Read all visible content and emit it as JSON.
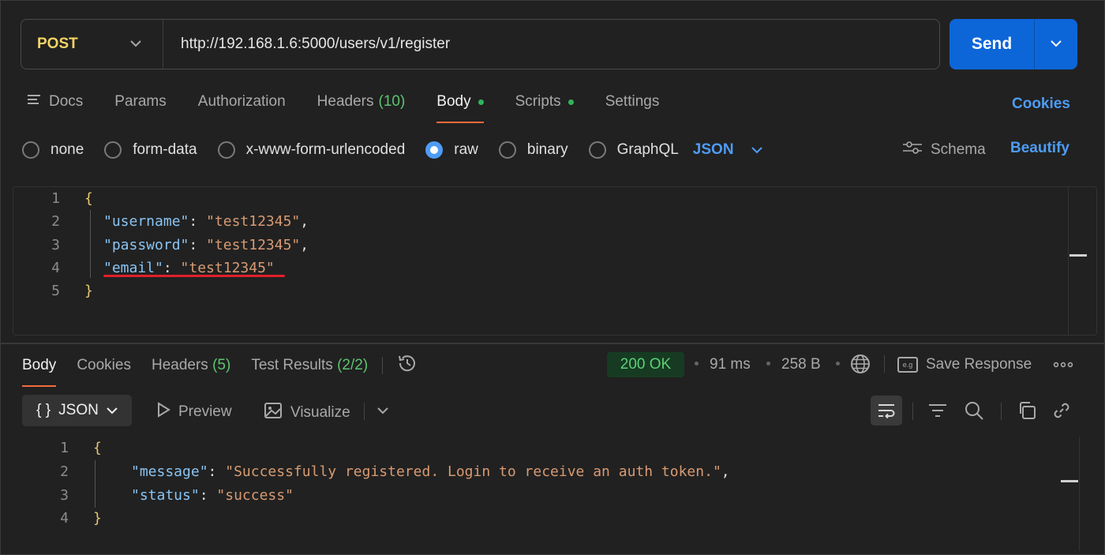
{
  "request": {
    "method": "POST",
    "url": "http://192.168.1.6:5000/users/v1/register",
    "send_label": "Send"
  },
  "request_tabs": {
    "docs": "Docs",
    "params": "Params",
    "authorization": "Authorization",
    "headers": "Headers",
    "headers_count": "(10)",
    "body": "Body",
    "scripts": "Scripts",
    "settings": "Settings",
    "cookies": "Cookies"
  },
  "body_types": {
    "none": "none",
    "form_data": "form-data",
    "urlencoded": "x-www-form-urlencoded",
    "raw": "raw",
    "binary": "binary",
    "graphql": "GraphQL",
    "format": "JSON",
    "schema": "Schema",
    "beautify": "Beautify",
    "selected": "raw"
  },
  "request_body": {
    "line_numbers": [
      "1",
      "2",
      "3",
      "4",
      "5"
    ],
    "open_brace": "{",
    "close_brace": "}",
    "fields": [
      {
        "key": "\"username\"",
        "value": "\"test12345\"",
        "trail": ","
      },
      {
        "key": "\"password\"",
        "value": "\"test12345\"",
        "trail": ","
      },
      {
        "key": "\"email\"",
        "value": "\"test12345\"",
        "trail": ""
      }
    ]
  },
  "response_tabs": {
    "body": "Body",
    "cookies": "Cookies",
    "headers": "Headers",
    "headers_count": "(5)",
    "test_results": "Test Results",
    "test_count": "(2/2)"
  },
  "response_meta": {
    "status": "200 OK",
    "time": "91 ms",
    "size": "258 B",
    "save_response": "Save Response",
    "save_icon_text": "e.g"
  },
  "response_toolbar": {
    "format": "JSON",
    "format_icon": "{ }",
    "preview": "Preview",
    "visualize": "Visualize"
  },
  "response_body": {
    "line_numbers": [
      "1",
      "2",
      "3",
      "4"
    ],
    "open_brace": "{",
    "close_brace": "}",
    "fields": [
      {
        "key": "\"message\"",
        "value": "\"Successfully registered. Login to receive an auth token.\"",
        "trail": ","
      },
      {
        "key": "\"status\"",
        "value": "\"success\"",
        "trail": ""
      }
    ]
  },
  "colors": {
    "accent_blue": "#0c66d8",
    "link_blue": "#4e9cf5",
    "method_yellow": "#f4d465",
    "success_green": "#5fcf78",
    "active_tab_orange": "#f26b3a",
    "annotation_red": "#e0202a"
  },
  "icons": {
    "method_dropdown": "chevron-down-icon",
    "send_dropdown": "chevron-down-icon",
    "docs": "docs-lines-icon",
    "schema": "sliders-icon",
    "history": "history-icon",
    "network": "globe-icon",
    "save": "save-example-icon",
    "more": "ellipsis-icon",
    "preview": "play-icon",
    "visualize": "image-icon",
    "wrap": "wrap-lines-icon",
    "filter": "filter-icon",
    "search": "search-icon",
    "copy": "copy-icon",
    "link": "link-icon"
  }
}
